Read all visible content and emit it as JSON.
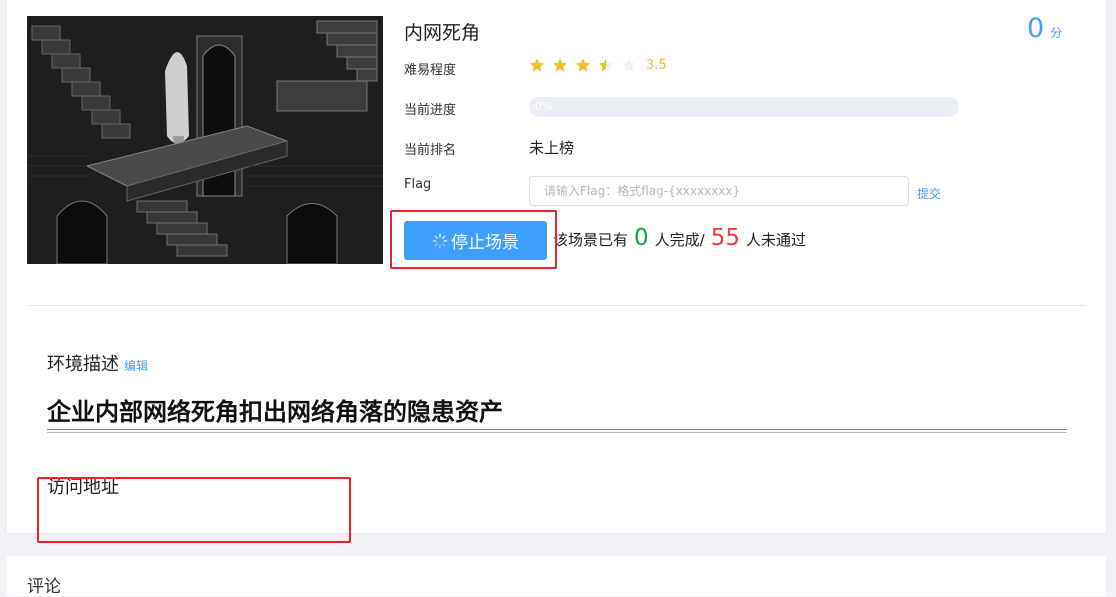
{
  "scene": {
    "title": "内网死角",
    "score": "0",
    "score_unit": "分",
    "difficulty_label": "难易程度",
    "difficulty_rating": 3.5,
    "difficulty_text": "3.5",
    "progress_label": "当前进度",
    "progress_value": 0,
    "progress_text": "0%",
    "rank_label": "当前排名",
    "rank_value": "未上榜",
    "flag_label": "Flag",
    "flag_placeholder": "请输入Flag：格式flag-{xxxxxxxx}",
    "submit_label": "提交",
    "stop_button_label": "停止场景",
    "stats_prefix": "该场景已有",
    "completed_count": "0",
    "stats_mid": "人完成/",
    "failed_count": "55",
    "stats_suffix": "人未通过"
  },
  "description": {
    "title": "环境描述",
    "edit_label": "编辑",
    "body": "企业内部网络死角扣出网络角落的隐患资产"
  },
  "access": {
    "title": "访问地址"
  },
  "comments": {
    "title": "评论"
  },
  "colors": {
    "primary": "#409eff",
    "star": "#f7ba2a",
    "success": "#13a54a",
    "danger": "#f23c3c",
    "highlight_box": "#e6242b"
  },
  "icons": {
    "difficulty": "star-icon",
    "stop_button": "loading-spinner-icon"
  }
}
